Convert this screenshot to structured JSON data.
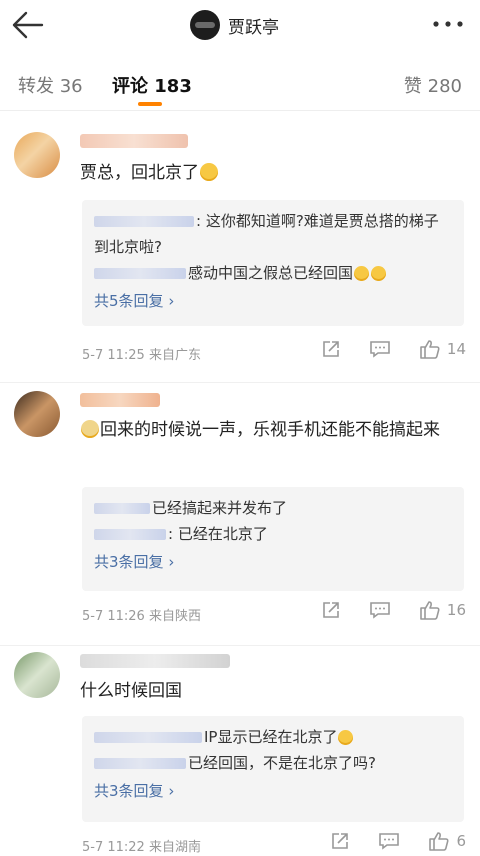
{
  "header": {
    "title": "贾跃亭"
  },
  "tabs": {
    "repost_label": "转发",
    "repost_count": "36",
    "comment_label": "评论",
    "comment_count": "183",
    "like_label": "赞",
    "like_count": "280"
  },
  "colors": {
    "accent": "#ff8200",
    "link": "#4a6fa5"
  },
  "comments": [
    {
      "text": "贾总，回北京了",
      "replies": [
        {
          "text": ": 这你都知道啊?难道是贾总搭的梯子到北京啦?"
        },
        {
          "text": "感动中国之假总已经回国"
        }
      ],
      "more": "共5条回复",
      "time": "5-7 11:25",
      "location": "来自广东",
      "likes": "14"
    },
    {
      "text": "回来的时候说一声，乐视手机还能不能搞起来",
      "replies": [
        {
          "text": "已经搞起来并发布了"
        },
        {
          "text": ": 已经在北京了"
        }
      ],
      "more": "共3条回复",
      "time": "5-7 11:26",
      "location": "来自陕西",
      "likes": "16"
    },
    {
      "text": "什么时候回国",
      "replies": [
        {
          "text": "IP显示已经在北京了"
        },
        {
          "text": "已经回国，不是在北京了吗?"
        }
      ],
      "more": "共3条回复",
      "time": "5-7 11:22",
      "location": "来自湖南",
      "likes": "6"
    }
  ]
}
